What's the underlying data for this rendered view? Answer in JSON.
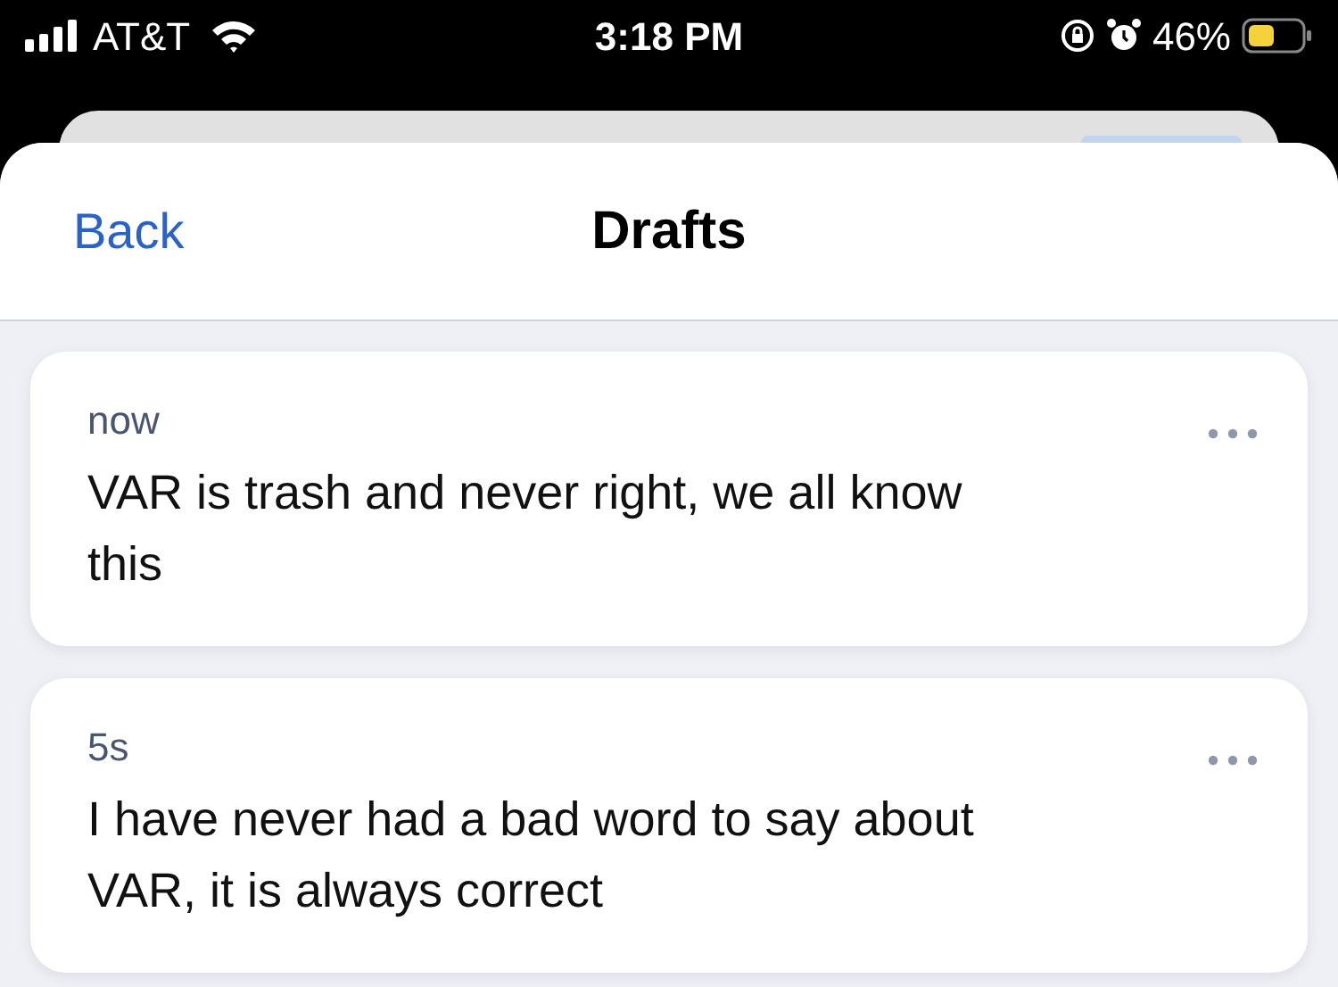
{
  "status_bar": {
    "carrier": "AT&T",
    "time": "3:18 PM",
    "battery": "46%"
  },
  "nav": {
    "back": "Back",
    "title": "Drafts"
  },
  "drafts": [
    {
      "time": "now",
      "text": "VAR is trash and never right, we all know this"
    },
    {
      "time": "5s",
      "text": "I have never had a bad word to say about VAR, it is always correct"
    }
  ]
}
